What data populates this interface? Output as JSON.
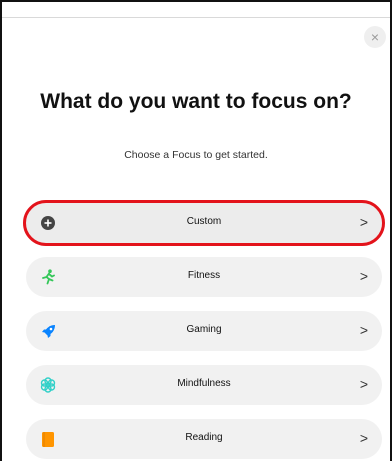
{
  "dialog": {
    "close_glyph": "×",
    "title": "What do you want to focus on?",
    "subtitle": "Choose a Focus to get started."
  },
  "focus_options": [
    {
      "label": "Custom",
      "icon": "plus-circle-icon",
      "color": "#444444",
      "selected": true
    },
    {
      "label": "Fitness",
      "icon": "running-figure-icon",
      "color": "#34c759",
      "selected": false
    },
    {
      "label": "Gaming",
      "icon": "rocket-icon",
      "color": "#0a84ff",
      "selected": false
    },
    {
      "label": "Mindfulness",
      "icon": "flower-icon",
      "color": "#30d0c8",
      "selected": false
    },
    {
      "label": "Reading",
      "icon": "book-icon",
      "color": "#ff9500",
      "selected": false
    }
  ],
  "chevron_glyph": ">",
  "highlight_color": "#e3131b"
}
